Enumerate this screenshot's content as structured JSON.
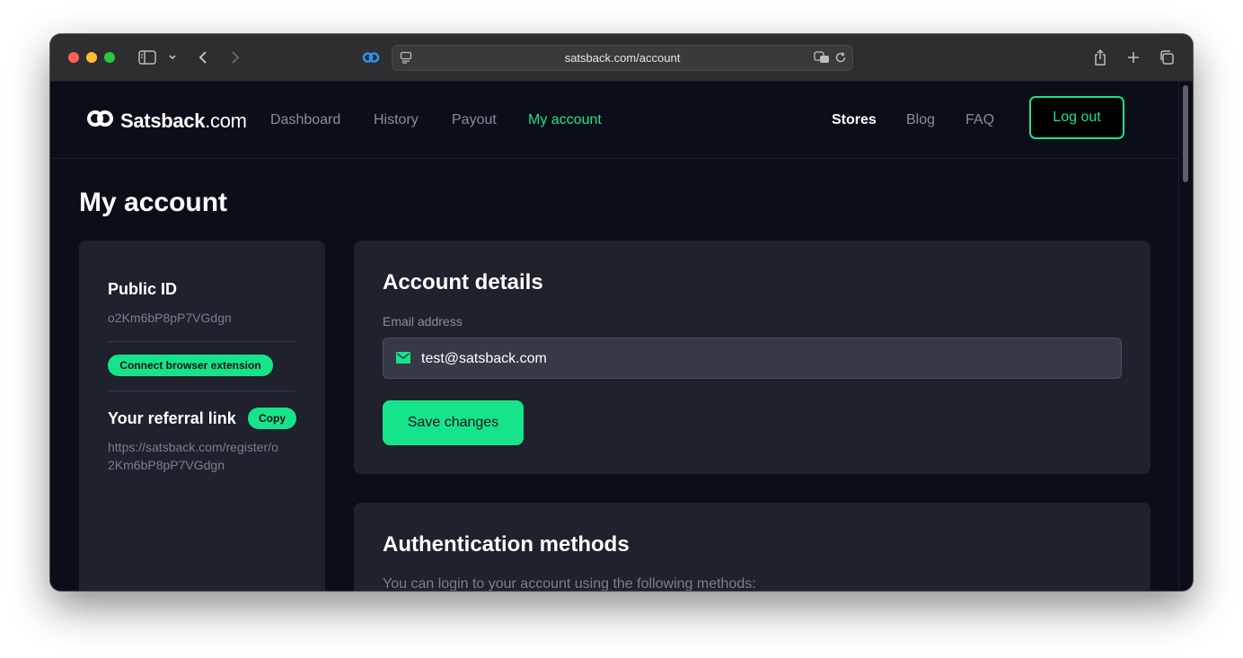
{
  "browser": {
    "url": "satsback.com/account"
  },
  "nav": {
    "logo_main": "Satsback",
    "logo_suffix": ".com",
    "links": [
      {
        "label": "Dashboard"
      },
      {
        "label": "History"
      },
      {
        "label": "Payout"
      },
      {
        "label": "My account"
      }
    ],
    "right_links": [
      {
        "label": "Stores"
      },
      {
        "label": "Blog"
      },
      {
        "label": "FAQ"
      }
    ],
    "logout_label": "Log out"
  },
  "page": {
    "title": "My account"
  },
  "sidebar": {
    "public_id_heading": "Public ID",
    "public_id_value": "o2Km6bP8pP7VGdgn",
    "connect_label": "Connect browser extension",
    "referral_heading": "Your referral link",
    "copy_label": "Copy",
    "referral_line1": "https://satsback.com/register/o",
    "referral_line2": "2Km6bP8pP7VGdgn"
  },
  "account_details": {
    "heading": "Account details",
    "email_label": "Email address",
    "email_value": "test@satsback.com",
    "save_label": "Save changes"
  },
  "auth_methods": {
    "heading": "Authentication methods",
    "description": "You can login to your account using the following methods:"
  },
  "colors": {
    "accent": "#16e48a",
    "background": "#0b0e19",
    "card": "#1f212d"
  }
}
